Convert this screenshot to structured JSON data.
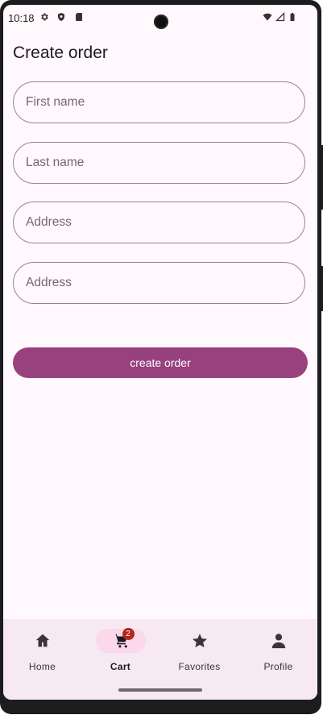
{
  "status_bar": {
    "time": "10:18",
    "left_icons": [
      "gear-icon",
      "shield-icon",
      "sd-card-icon"
    ],
    "right_icons": [
      "wifi-icon",
      "signal-icon",
      "battery-icon"
    ]
  },
  "page": {
    "title": "Create order"
  },
  "form": {
    "fields": [
      {
        "placeholder": "First name",
        "value": ""
      },
      {
        "placeholder": "Last name",
        "value": ""
      },
      {
        "placeholder": "Address",
        "value": ""
      },
      {
        "placeholder": "Address",
        "value": ""
      }
    ],
    "submit_label": "create order"
  },
  "bottom_nav": {
    "items": [
      {
        "label": "Home",
        "icon": "home-icon",
        "active": false
      },
      {
        "label": "Cart",
        "icon": "cart-icon",
        "active": true,
        "badge": "2"
      },
      {
        "label": "Favorites",
        "icon": "star-icon",
        "active": false
      },
      {
        "label": "Profile",
        "icon": "profile-icon",
        "active": false
      }
    ]
  },
  "colors": {
    "accent": "#98417f",
    "background": "#fff8fc",
    "nav_background": "#f6e9f1",
    "active_pill": "#fbd8ea",
    "badge": "#b3261e"
  }
}
